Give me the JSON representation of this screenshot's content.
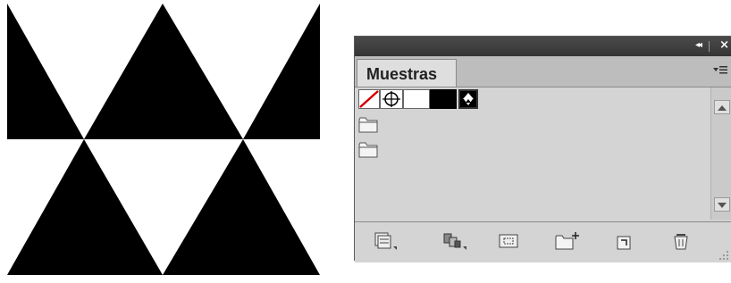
{
  "panel": {
    "title_buttons": {
      "collapse": "◂◂",
      "close": "×"
    },
    "tab_label": "Muestras",
    "menu_icon": "panel-menu-icon",
    "swatches": [
      {
        "name": "none",
        "icon": "none-swatch-icon"
      },
      {
        "name": "registration",
        "icon": "registration-icon"
      },
      {
        "name": "white",
        "color": "#ffffff"
      },
      {
        "name": "black",
        "color": "#000000"
      },
      {
        "name": "triangle-pattern",
        "icon": "pattern-swatch-icon"
      }
    ],
    "folders": [
      {
        "icon": "folder-icon"
      },
      {
        "icon": "folder-icon"
      }
    ],
    "bottom_buttons": [
      {
        "icon": "swatch-libraries-icon"
      },
      {
        "icon": "show-kinds-icon"
      },
      {
        "icon": "swatch-options-icon"
      },
      {
        "icon": "new-color-group-icon"
      },
      {
        "icon": "new-swatch-icon"
      },
      {
        "icon": "delete-swatch-icon"
      }
    ]
  },
  "colors": {
    "artwork_fill": "#000000",
    "panel_bg": "#d4d4d4",
    "titlebar_bg": "#3d3d3d",
    "none_slash": "#d40000"
  }
}
